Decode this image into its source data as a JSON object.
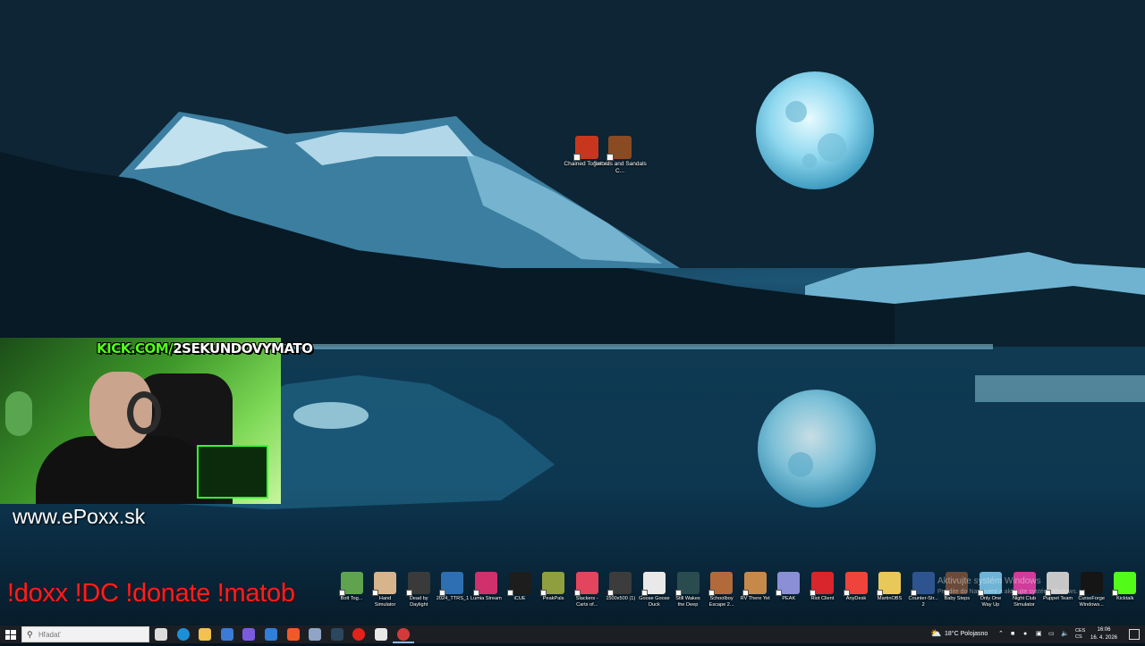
{
  "desktop_icons": [
    {
      "label": "Chained Together",
      "color": "#c8371d"
    },
    {
      "label": "Swords and Sandals C...",
      "color": "#8a4a22"
    }
  ],
  "overlay": {
    "kick_prefix": "KICK.COM/",
    "kick_channel": "2SEKUNDOVYMATO",
    "site": "www.ePoxx.sk",
    "commands": "!doxx  !DC !donate !matob"
  },
  "shortcut_row": [
    {
      "label": "Bolt Tog...",
      "color": "#5fa34e"
    },
    {
      "label": "Hand Simulator",
      "color": "#d7b48c"
    },
    {
      "label": "Dead by Daylight",
      "color": "#3a3a3a"
    },
    {
      "label": "2024_TTRS_1",
      "color": "#2f6fb1"
    },
    {
      "label": "Lumia Stream",
      "color": "#d0316d"
    },
    {
      "label": "iCUE",
      "color": "#1d1d1d"
    },
    {
      "label": "PeakPals",
      "color": "#8f9f3f"
    },
    {
      "label": "Slackers - Carts of...",
      "color": "#e2455d"
    },
    {
      "label": "1500x500 (1)",
      "color": "#3c3c3c"
    },
    {
      "label": "Goose Goose Duck",
      "color": "#e9e9e9"
    },
    {
      "label": "Still Wakes the Deep",
      "color": "#2b4c4f"
    },
    {
      "label": "Schoolboy Escape 2...",
      "color": "#b36a3a"
    },
    {
      "label": "RV There Yet",
      "color": "#c7894a"
    },
    {
      "label": "PEAK",
      "color": "#8a8fd6"
    },
    {
      "label": "Riot Client",
      "color": "#d8262c"
    },
    {
      "label": "AnyDesk",
      "color": "#ef443b"
    },
    {
      "label": "MartinOBS",
      "color": "#e9c85a"
    },
    {
      "label": "Counter-Str... 2",
      "color": "#2e5490"
    },
    {
      "label": "Baby Steps",
      "color": "#6a4b39"
    },
    {
      "label": "Only One Way Up",
      "color": "#6fb4d6"
    },
    {
      "label": "Night Club Simulator",
      "color": "#cf3c9a"
    },
    {
      "label": "Puppet Team",
      "color": "#c7c7c7"
    },
    {
      "label": "CurseForge Windows...",
      "color": "#151515"
    },
    {
      "label": "Kicktalk",
      "color": "#53fc18"
    }
  ],
  "watermark": {
    "line1": "Aktivujte systém Windows",
    "line2": "Prejdite do Nastavení a aktivujte systém Windows."
  },
  "taskbar": {
    "search_placeholder": "Hľadať",
    "pinned": [
      {
        "icon": "task-view-icon",
        "color": "#dddddd"
      },
      {
        "icon": "edge-icon",
        "color": "#1d8fd6"
      },
      {
        "icon": "file-explorer-icon",
        "color": "#f2c14e"
      },
      {
        "icon": "store-icon",
        "color": "#3b7bd6"
      },
      {
        "icon": "colorful-app-icon",
        "color": "#7a5be0"
      },
      {
        "icon": "mail-icon",
        "color": "#2f7fd8"
      },
      {
        "icon": "brave-icon",
        "color": "#f05a28"
      },
      {
        "icon": "app-icon",
        "color": "#8fa5c7"
      },
      {
        "icon": "steam-icon",
        "color": "#2a475e"
      },
      {
        "icon": "opera-icon",
        "color": "#e2231a"
      },
      {
        "icon": "obs-icon",
        "color": "#e8e8e8"
      },
      {
        "icon": "recording-icon",
        "color": "#d33b3b"
      }
    ],
    "weather": "18°C  Polojasno",
    "language": "CES\nCS",
    "time": "16:06",
    "date": "16. 4. 2026"
  }
}
